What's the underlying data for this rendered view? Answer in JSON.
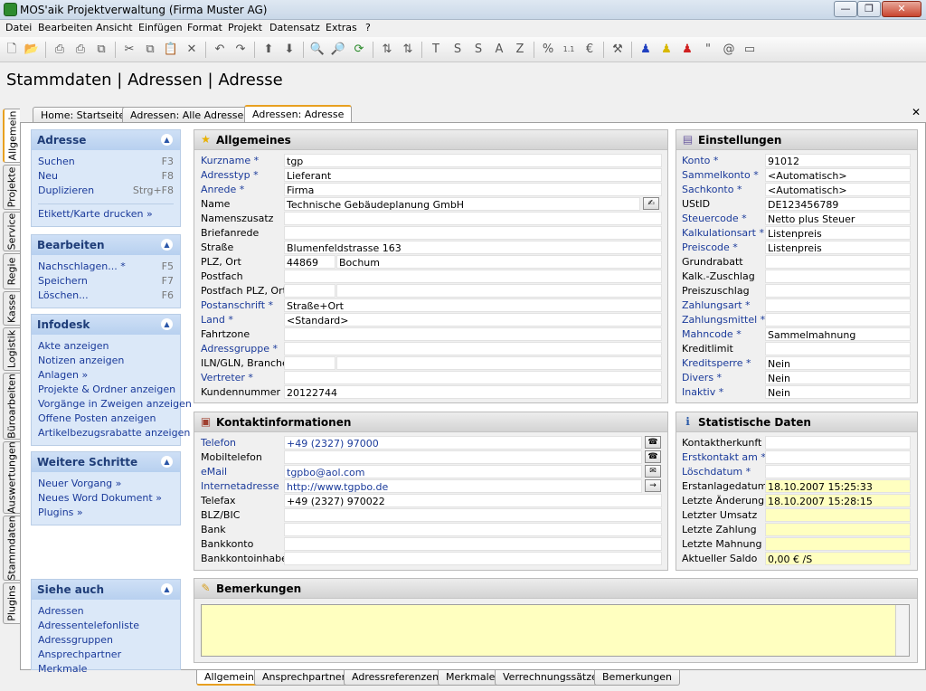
{
  "window": {
    "title": "MOS'aik Projektverwaltung (Firma Muster AG)"
  },
  "menu": [
    "Datei",
    "Bearbeiten",
    "Ansicht",
    "Einfügen",
    "Format",
    "Projekt",
    "Datensatz",
    "Extras",
    "?"
  ],
  "toolbar": {
    "text_buttons": [
      "T",
      "S",
      "S",
      "A",
      "Z"
    ],
    "quote_label": "\"",
    "at_label": "@"
  },
  "page_title": "Stammdaten | Adressen | Adresse",
  "doc_tabs": [
    "Home: Startseite",
    "Adressen: Alle Adressen",
    "Adressen: Adresse"
  ],
  "vertical_tabs": [
    "Allgemein",
    "Projekte",
    "Service",
    "Regie",
    "Kasse",
    "Logistik",
    "Büroarbeiten",
    "Auswertungen",
    "Stammdaten",
    "Plugins"
  ],
  "task_panels": {
    "adresse": {
      "title": "Adresse",
      "items": [
        {
          "label": "Suchen",
          "key": "F3"
        },
        {
          "label": "Neu",
          "key": "F8"
        },
        {
          "label": "Duplizieren",
          "key": "Strg+F8"
        }
      ],
      "extra": "Etikett/Karte drucken »"
    },
    "bearbeiten": {
      "title": "Bearbeiten",
      "items": [
        {
          "label": "Nachschlagen... *",
          "key": "F5"
        },
        {
          "label": "Speichern",
          "key": "F7"
        },
        {
          "label": "Löschen...",
          "key": "F6"
        }
      ]
    },
    "infodesk": {
      "title": "Infodesk",
      "items": [
        "Akte anzeigen",
        "Notizen anzeigen",
        "Anlagen »",
        "Projekte & Ordner anzeigen",
        "Vorgänge in Zweigen anzeigen",
        "Offene Posten anzeigen",
        "Artikelbezugsrabatte anzeigen"
      ]
    },
    "weitere": {
      "title": "Weitere Schritte",
      "items": [
        "Neuer Vorgang »",
        "Neues Word Dokument »",
        "Plugins »"
      ]
    },
    "siehe": {
      "title": "Siehe auch",
      "items": [
        "Adressen",
        "Adressentelefonliste",
        "Adressgruppen",
        "Ansprechpartner",
        "Merkmale"
      ]
    }
  },
  "allgemeines": {
    "title": "Allgemeines",
    "rows": [
      {
        "label": "Kurzname *",
        "value": "tgp",
        "link": true
      },
      {
        "label": "Adresstyp *",
        "value": "Lieferant",
        "link": true
      },
      {
        "label": "Anrede *",
        "value": "Firma",
        "link": true
      },
      {
        "label": "Name",
        "value": "Technische Gebäudeplanung GmbH",
        "link": false
      },
      {
        "label": "Namenszusatz",
        "value": "",
        "link": false
      },
      {
        "label": "Briefanrede",
        "value": "",
        "link": false
      },
      {
        "label": "Straße",
        "value": "Blumenfeldstrasse 163",
        "link": false
      },
      {
        "label": "PLZ, Ort",
        "value": "44869",
        "value2": "Bochum",
        "link": false
      },
      {
        "label": "Postfach",
        "value": "",
        "link": false
      },
      {
        "label": "Postfach PLZ, Ort",
        "value": "",
        "value2": "",
        "link": false
      },
      {
        "label": "Postanschrift *",
        "value": "Straße+Ort",
        "link": true
      },
      {
        "label": "Land *",
        "value": "<Standard>",
        "link": true
      },
      {
        "label": "Fahrtzone",
        "value": "",
        "link": false
      },
      {
        "label": "Adressgruppe *",
        "value": "",
        "link": true
      },
      {
        "label": "ILN/GLN, Branche",
        "value": "",
        "value2": "",
        "link": false
      },
      {
        "label": "Vertreter *",
        "value": "",
        "link": true
      },
      {
        "label": "Kundennummer",
        "value": "20122744",
        "link": false
      }
    ]
  },
  "einstellungen": {
    "title": "Einstellungen",
    "rows": [
      {
        "label": "Konto *",
        "value": "91012",
        "link": true
      },
      {
        "label": "Sammelkonto *",
        "value": "<Automatisch>",
        "link": true
      },
      {
        "label": "Sachkonto *",
        "value": "<Automatisch>",
        "link": true
      },
      {
        "label": "UStID",
        "value": "DE123456789",
        "link": false
      },
      {
        "label": "Steuercode *",
        "value": "Netto plus Steuer",
        "link": true
      },
      {
        "label": "Kalkulationsart *",
        "value": "Listenpreis",
        "link": true
      },
      {
        "label": "Preiscode *",
        "value": "Listenpreis",
        "link": true
      },
      {
        "label": "Grundrabatt",
        "value": "",
        "link": false
      },
      {
        "label": "Kalk.-Zuschlag",
        "value": "",
        "link": false
      },
      {
        "label": "Preiszuschlag",
        "value": "",
        "link": false
      },
      {
        "label": "Zahlungsart *",
        "value": "",
        "link": true
      },
      {
        "label": "Zahlungsmittel *",
        "value": "",
        "link": true
      },
      {
        "label": "Mahncode *",
        "value": "Sammelmahnung",
        "link": true
      },
      {
        "label": "Kreditlimit",
        "value": "",
        "link": false
      },
      {
        "label": "Kreditsperre *",
        "value": "Nein",
        "link": true
      },
      {
        "label": "Divers *",
        "value": "Nein",
        "link": true
      },
      {
        "label": "Inaktiv *",
        "value": "Nein",
        "link": true
      }
    ]
  },
  "kontakt": {
    "title": "Kontaktinformationen",
    "rows": [
      {
        "label": "Telefon",
        "value": "+49 (2327) 97000",
        "link": true,
        "btn": "☎"
      },
      {
        "label": "Mobiltelefon",
        "value": "",
        "link": false,
        "btn": "☎"
      },
      {
        "label": "eMail",
        "value": "tgpbo@aol.com",
        "link": true,
        "btn": "✉"
      },
      {
        "label": "Internetadresse",
        "value": "http://www.tgpbo.de",
        "link": true,
        "btn": "→"
      },
      {
        "label": "Telefax",
        "value": "+49 (2327) 970022",
        "link": false
      },
      {
        "label": "BLZ/BIC",
        "value": "",
        "link": false
      },
      {
        "label": "Bank",
        "value": "",
        "link": false
      },
      {
        "label": "Bankkonto",
        "value": "",
        "link": false
      },
      {
        "label": "Bankkontoinhaber",
        "value": "",
        "link": false
      }
    ]
  },
  "statistik": {
    "title": "Statistische Daten",
    "rows": [
      {
        "label": "Kontaktherkunft",
        "value": "",
        "link": false,
        "yellow": false
      },
      {
        "label": "Erstkontakt am *",
        "value": "",
        "link": true,
        "yellow": false
      },
      {
        "label": "Löschdatum *",
        "value": "",
        "link": true,
        "yellow": false
      },
      {
        "label": "Erstanlagedatum",
        "value": "18.10.2007 15:25:33",
        "link": false,
        "yellow": true
      },
      {
        "label": "Letzte Änderung",
        "value": "18.10.2007 15:28:15",
        "link": false,
        "yellow": true
      },
      {
        "label": "Letzter Umsatz",
        "value": "",
        "link": false,
        "yellow": true
      },
      {
        "label": "Letzte Zahlung",
        "value": "",
        "link": false,
        "yellow": true
      },
      {
        "label": "Letzte Mahnung",
        "value": "",
        "link": false,
        "yellow": true
      },
      {
        "label": "Aktueller Saldo",
        "value": "0,00 € /S",
        "link": false,
        "yellow": true
      }
    ]
  },
  "bemerkungen": {
    "title": "Bemerkungen",
    "text": ""
  },
  "bottom_tabs": [
    "Allgemein",
    "Ansprechpartner",
    "Adressreferenzen",
    "Merkmale",
    "Verrechnungssätze",
    "Bemerkungen"
  ],
  "colors": {
    "link": "#1a3a9a",
    "accent": "#e8a020",
    "taskpane": "#dbe8f8",
    "highlight": "#ffffc0"
  }
}
